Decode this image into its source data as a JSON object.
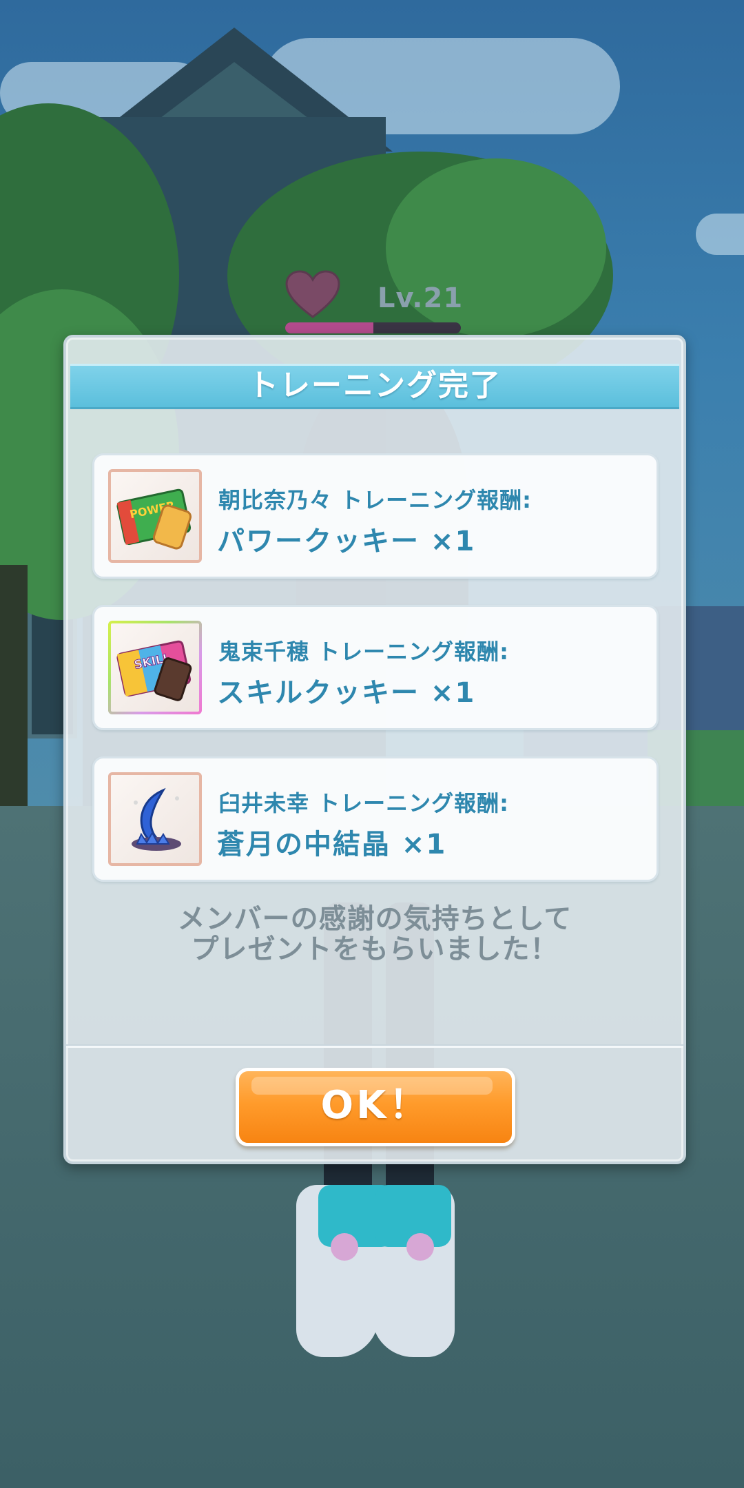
{
  "hud": {
    "level": "Lv.21",
    "affection_icon": "heart-icon",
    "affection_progress": 0.5
  },
  "dialog": {
    "title": "トレーニング完了",
    "rewards": [
      {
        "label": "朝比奈乃々 トレーニング報酬:",
        "item": "パワークッキー ×1",
        "icon": "power-cookie-icon",
        "icon_text": "POWER"
      },
      {
        "label": "鬼束千穂 トレーニング報酬:",
        "item": "スキルクッキー ×1",
        "icon": "skill-cookie-icon",
        "icon_text": "SKILL"
      },
      {
        "label": "臼井未幸 トレーニング報酬:",
        "item": "蒼月の中結晶 ×1",
        "icon": "blue-moon-crystal-icon"
      }
    ],
    "message_line1": "メンバーの感謝の気持ちとして",
    "message_line2": "プレゼントをもらいました！",
    "ok_label": "OK！"
  }
}
